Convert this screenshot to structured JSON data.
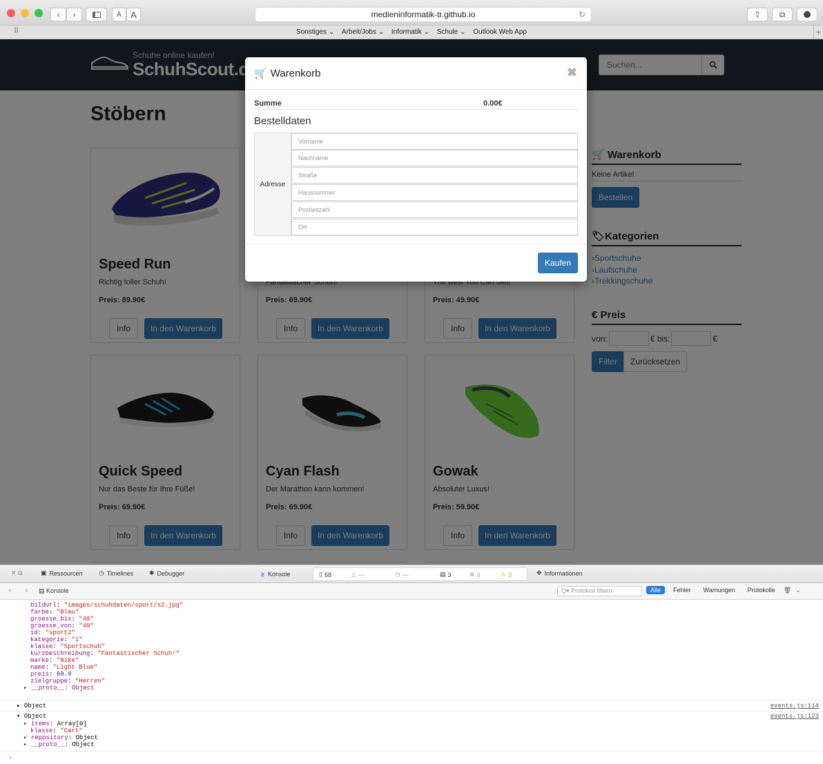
{
  "browser": {
    "url": "medieninformatik-tr.github.io",
    "font_small": "A",
    "font_large": "A",
    "bookmarks": [
      "Sonstiges",
      "Arbeit/Jobs",
      "Informatik",
      "Schule",
      "Outlook Web App"
    ]
  },
  "site": {
    "tagline": "Schuhe online kaufen!",
    "name": "SchuhScout.de",
    "search_placeholder": "Suchen...",
    "page_title": "Stöbern",
    "info_label": "Info",
    "cart_label": "In den Warenkorb",
    "products": [
      {
        "name": "Speed Run",
        "desc": "Richtig toller Schuh!",
        "price": "Preis: 89.90€"
      },
      {
        "name": "",
        "desc": "Fantastischer Schuh!",
        "price": "Preis: 69.90€"
      },
      {
        "name": "",
        "desc": "The Best You Can Get!",
        "price": "Preis: 49.90€"
      },
      {
        "name": "Quick Speed",
        "desc": "Nur das Beste für Ihre Füße!",
        "price": "Preis: 69.90€"
      },
      {
        "name": "Cyan Flash",
        "desc": "Der Marathon kann kommen!",
        "price": "Preis: 69.90€"
      },
      {
        "name": "Gowak",
        "desc": "Absoluter Luxus!",
        "price": "Preis: 59.90€"
      }
    ]
  },
  "sidebar": {
    "cart_title": "Warenkorb",
    "cart_empty": "Keine Artikel",
    "order_button": "Bestellen",
    "categories_title": "Kategorien",
    "categories": [
      "Sportschuhe",
      "Laufschuhe",
      "Trekkingschuhe"
    ],
    "price_title": "€ Preis",
    "price_from": "von:",
    "price_to": "€ bis:",
    "price_unit": "€",
    "filter_button": "Filter",
    "reset_button": "Zurücksetzen"
  },
  "modal": {
    "title": "Warenkorb",
    "sum_label": "Summe",
    "sum_value": "0.00€",
    "order_data_title": "Bestelldaten",
    "address_label": "Adresse",
    "fields": [
      "Vorname",
      "Nachname",
      "Straße",
      "Hausnummer",
      "Postleitzahl",
      "Ort"
    ],
    "buy_button": "Kaufen"
  },
  "devtools": {
    "tabs": [
      "Ressourcen",
      "Timelines",
      "Debugger"
    ],
    "console_tab": "Konsole",
    "info_tab": "Informationen",
    "resource_count": "68",
    "net_count": "—",
    "time_count": "—",
    "messages": "3",
    "errors": "0",
    "warnings": "3",
    "breadcrumb": "Konsole",
    "filter_placeholder": "Protokoll filtern",
    "scopes": [
      "Alle",
      "Fehler",
      "Warnungen",
      "Protokolle"
    ],
    "props": [
      {
        "k": "bildUrl",
        "v": "\"images/schuhdaten/sport/s2.jpg\"",
        "t": "str"
      },
      {
        "k": "farbe",
        "v": "\"Blau\"",
        "t": "str"
      },
      {
        "k": "groesse_bis",
        "v": "\"48\"",
        "t": "str"
      },
      {
        "k": "groesse_von",
        "v": "\"40\"",
        "t": "str"
      },
      {
        "k": "id",
        "v": "\"sport2\"",
        "t": "str"
      },
      {
        "k": "kategorie",
        "v": "\"1\"",
        "t": "str"
      },
      {
        "k": "klasse",
        "v": "\"Sportschuh\"",
        "t": "str"
      },
      {
        "k": "kurzbeschreibung",
        "v": "\"Fantastischer Schuh!\"",
        "t": "str"
      },
      {
        "k": "marke",
        "v": "\"Nike\"",
        "t": "str"
      },
      {
        "k": "name",
        "v": "\"Light Blue\"",
        "t": "str"
      },
      {
        "k": "preis",
        "v": "69.9",
        "t": "num"
      },
      {
        "k": "zielgruppe",
        "v": "\"Herren\"",
        "t": "str"
      }
    ],
    "proto": "▸ __proto__: Object",
    "entry1": "▸ Object",
    "entry1_src": "events.js:114",
    "entry2": "▾ Object",
    "entry2_src": "events.js:123",
    "entry2_props": [
      {
        "k": "▸ items",
        "v": "Array[0]",
        "t": "plain"
      },
      {
        "k": "klasse",
        "v": "\"Cart\"",
        "t": "str"
      },
      {
        "k": "▸ repository",
        "v": "Object",
        "t": "plain"
      },
      {
        "k": "▸ __proto__",
        "v": "Object",
        "t": "plain"
      }
    ]
  }
}
